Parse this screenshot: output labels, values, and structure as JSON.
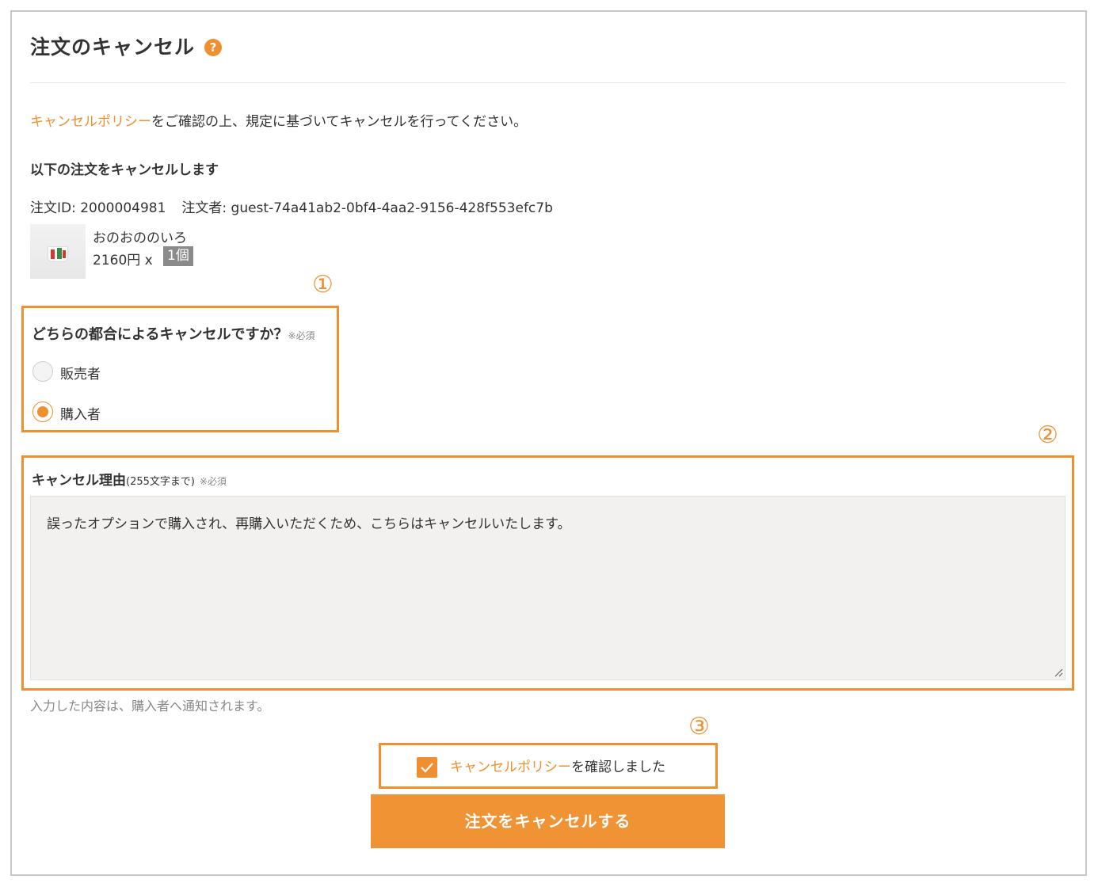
{
  "header": {
    "title": "注文のキャンセル",
    "help_icon": "?"
  },
  "intro": {
    "policy_link": "キャンセルポリシー",
    "text": "をご確認の上、規定に基づいてキャンセルを行ってください。"
  },
  "order": {
    "heading": "以下の注文をキャンセルします",
    "order_id": "注文ID: 2000004981",
    "orderer": "注文者: guest-74a41ab2-0bf4-4aa2-9156-428f553efc7b",
    "product_name": "おのおののいろ",
    "price_qty": "2160円 x",
    "qty_badge": "1個"
  },
  "callouts": [
    "①",
    "②",
    "③"
  ],
  "question": {
    "label": "どちらの都合によるキャンセルですか？",
    "required": "※必須",
    "options": [
      {
        "label": "販売者",
        "checked": false
      },
      {
        "label": "購入者",
        "checked": true
      }
    ]
  },
  "reason": {
    "label": "キャンセル理由",
    "limit": "(255文字まで)",
    "required": "※必須",
    "value": "誤ったオプションで購入され、再購入いただくため、こちらはキャンセルいたします。",
    "hint": "入力した内容は、購入者へ通知されます。"
  },
  "confirm": {
    "policy_link": "キャンセルポリシー",
    "text": "を確認しました",
    "checked": true
  },
  "submit": {
    "label": "注文をキャンセルする"
  },
  "colors": {
    "accent": "#ef8f2f",
    "textarea_bg": "#f2f1ef"
  }
}
